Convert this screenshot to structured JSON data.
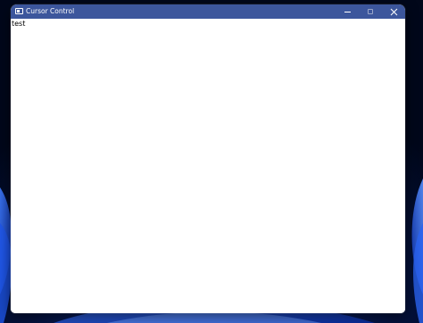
{
  "window": {
    "title": "Cursor Control",
    "titlebar_color": "#3c569c",
    "app_icon": "window-app-icon",
    "controls": {
      "minimize_icon": "minimize-icon",
      "maximize_icon": "maximize-icon",
      "close_icon": "close-icon"
    }
  },
  "client": {
    "text": "test",
    "background": "#ffffff"
  },
  "desktop": {
    "wallpaper": "windows-11-bloom-blue",
    "accent": "#1e5dff"
  }
}
